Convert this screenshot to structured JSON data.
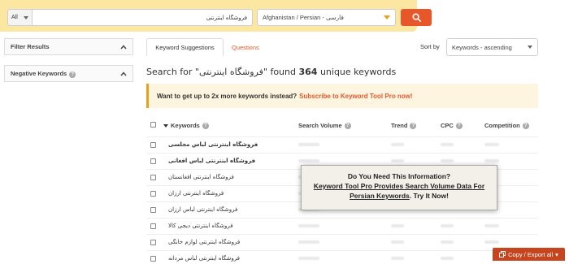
{
  "search": {
    "scope": "All",
    "query": "فروشگاه اینترنتی",
    "language": "Afghanistan / Persian - فارسی"
  },
  "filters": {
    "filter_results": "Filter Results",
    "negative_keywords": "Negative Keywords"
  },
  "tabs": {
    "suggestions": "Keyword Suggestions",
    "questions": "Questions"
  },
  "sort": {
    "label": "Sort by",
    "value": "Keywords - ascending"
  },
  "results": {
    "prefix": "Search for \"",
    "query": "فروشگاه اینترنتی",
    "middle": "\" found ",
    "count": "364",
    "suffix": " unique keywords"
  },
  "promo": {
    "text": "Want to get up to 2x more keywords instead?",
    "link": "Subscribe to Keyword Tool Pro now!"
  },
  "table": {
    "columns": {
      "keywords": "Keywords",
      "volume": "Search Volume",
      "trend": "Trend",
      "cpc": "CPC",
      "competition": "Competition"
    },
    "rows": [
      {
        "keyword": "فروشگاه اینترنتی لباس مجلسی"
      },
      {
        "keyword": "فروشگاه اینترنتی لباس افغانی"
      },
      {
        "keyword": "فروشگاه اینترنتی افغانستان"
      },
      {
        "keyword": "فروشگاه اینترنتی ارزان"
      },
      {
        "keyword": "فروشگاه اینترنتی لباس ارزان"
      },
      {
        "keyword": "فروشگاه اینترنتی دیجی کالا"
      },
      {
        "keyword": "فروشگاه اینترنتی لوازم خانگی"
      },
      {
        "keyword": "فروشگاه اینترنتی لباس مردانه"
      }
    ]
  },
  "overlay": {
    "title": "Do You Need This Information?",
    "link": "Keyword Tool Pro Provides Search Volume Data For Persian Keywords",
    "suffix": ". Try It Now!"
  },
  "export": {
    "label": "Copy / Export all"
  },
  "colors": {
    "accent": "#e8572a",
    "topbar": "#fbe7a1",
    "promo_bg": "#fdf5e0"
  }
}
